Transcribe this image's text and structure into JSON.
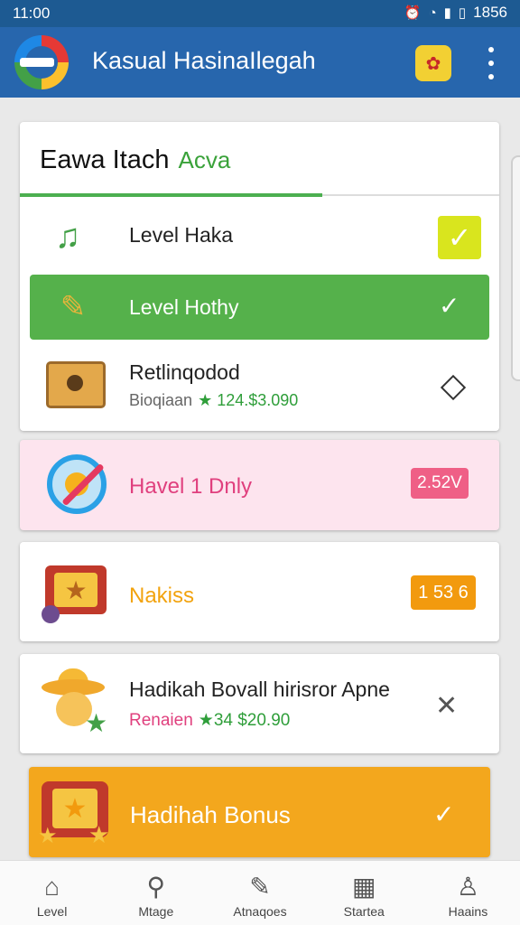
{
  "status_bar": {
    "time": "11:00",
    "right_text": "1856"
  },
  "app_bar": {
    "title": "Kasual HasinaIlegah"
  },
  "main_card": {
    "title": "Eawa Itach",
    "subtitle": "Acva",
    "rows": [
      {
        "label": "Level Haka",
        "icon": "music-note-icon",
        "checked": true
      },
      {
        "label": "Level Hothy",
        "icon": "ticket-icon",
        "checked": true,
        "highlighted": true
      },
      {
        "label": "Retlinqodod",
        "icon": "chest-icon",
        "meta_text": "Bioqiaan",
        "meta_price": "★ 124.$3.090"
      }
    ]
  },
  "cards": {
    "pink": {
      "label": "Havel 1 Dnly",
      "badge": "2.52V",
      "icon": "target-icon"
    },
    "nakiss": {
      "label": "Nakiss",
      "badge": "1 53 6",
      "icon": "treasure-frame-icon"
    },
    "hadikah": {
      "label": "Hadikah Bovall hirisror Apne",
      "meta_text": "Renaien",
      "meta_price": "★34 $20.90",
      "icon": "sombrero-character-icon"
    },
    "bonus": {
      "label": "Hadihah Bonus",
      "icon": "star-frame-icon"
    }
  },
  "bottom_nav": [
    {
      "label": "Level",
      "icon": "home-icon"
    },
    {
      "label": "Mtage",
      "icon": "search-icon"
    },
    {
      "label": "Atnaqoes",
      "icon": "edit-icon"
    },
    {
      "label": "Startea",
      "icon": "calendar-icon"
    },
    {
      "label": "Haains",
      "icon": "person-icon"
    }
  ],
  "colors": {
    "app_bar": "#2766ad",
    "accent_green": "#55b14b",
    "pink_bg": "#fde4ee",
    "orange": "#f3a71d"
  }
}
